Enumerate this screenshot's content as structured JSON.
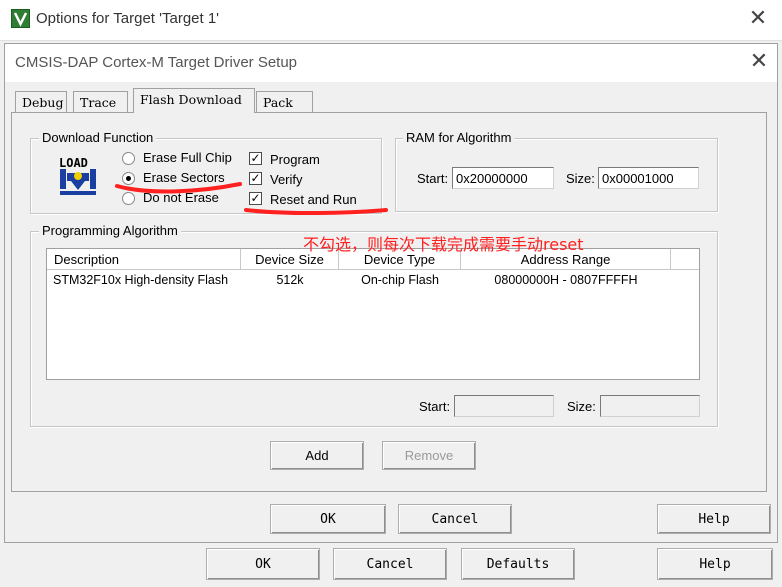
{
  "outer_window": {
    "title": "Options for Target 'Target 1'",
    "buttons": {
      "ok": "OK",
      "cancel": "Cancel",
      "defaults": "Defaults",
      "help": "Help"
    }
  },
  "dialog": {
    "title": "CMSIS-DAP Cortex-M Target Driver Setup",
    "tabs": [
      {
        "label": "Debug",
        "active": false
      },
      {
        "label": "Trace",
        "active": false
      },
      {
        "label": "Flash Download",
        "active": true
      },
      {
        "label": "Pack",
        "active": false
      }
    ],
    "download_function": {
      "label": "Download Function",
      "radios": [
        {
          "label": "Erase Full Chip",
          "selected": false
        },
        {
          "label": "Erase Sectors",
          "selected": true
        },
        {
          "label": "Do not Erase",
          "selected": false
        }
      ],
      "checks": [
        {
          "label": "Program",
          "checked": true
        },
        {
          "label": "Verify",
          "checked": true
        },
        {
          "label": "Reset and Run",
          "checked": true
        }
      ]
    },
    "ram_for_algorithm": {
      "label": "RAM for Algorithm",
      "start_label": "Start:",
      "start_value": "0x20000000",
      "size_label": "Size:",
      "size_value": "0x00001000"
    },
    "programming_algorithm": {
      "label": "Programming Algorithm",
      "columns": [
        "Description",
        "Device Size",
        "Device Type",
        "Address Range"
      ],
      "rows": [
        {
          "description": "STM32F10x High-density Flash",
          "device_size": "512k",
          "device_type": "On-chip Flash",
          "address_range": "08000000H - 0807FFFFH"
        }
      ],
      "start_label": "Start:",
      "start_value": "",
      "size_label": "Size:",
      "size_value": "",
      "add_label": "Add",
      "remove_label": "Remove"
    },
    "buttons": {
      "ok": "OK",
      "cancel": "Cancel",
      "help": "Help"
    }
  },
  "annotation": {
    "text": "不勾选，则每次下载完成需要手动reset",
    "color": "#ff2020"
  },
  "icons": {
    "app": "keil-uvision-icon",
    "load": "load-download-icon",
    "close": "close-icon"
  }
}
